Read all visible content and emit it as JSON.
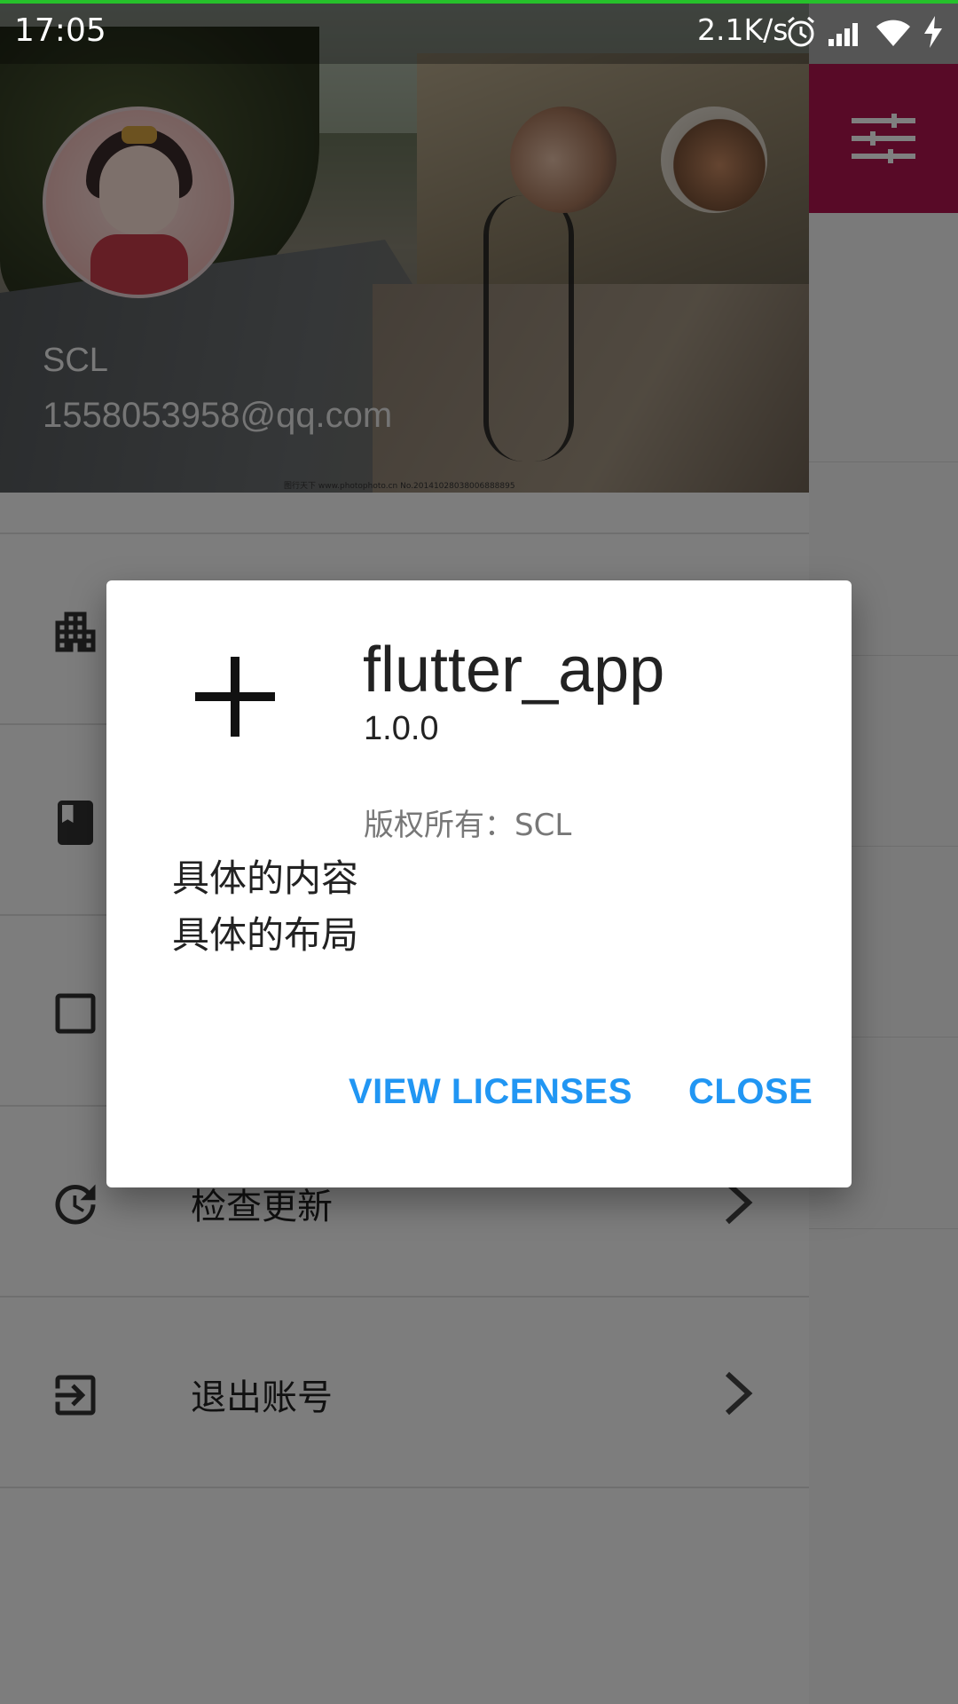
{
  "status_bar": {
    "time": "17:05",
    "net_speed": "2.1K/s",
    "icons": [
      "alarm-icon",
      "signal-icon",
      "wifi-icon",
      "charging-icon"
    ]
  },
  "app_bar": {
    "action_icon": "tune-icon"
  },
  "drawer": {
    "user": {
      "name": "SCL",
      "email": "1558053958@qq.com"
    },
    "watermark": "图行天下 www.photophoto.cn No.20141028038006888895",
    "items": [
      {
        "icon": "apartment-icon",
        "label": ""
      },
      {
        "icon": "book-icon",
        "label": ""
      },
      {
        "icon": "checkbox-icon",
        "label": ""
      },
      {
        "icon": "update-icon",
        "label": "检查更新"
      },
      {
        "icon": "logout-icon",
        "label": "退出账号"
      }
    ]
  },
  "dialog": {
    "app_icon": "add-icon",
    "app_name": "flutter_app",
    "version": "1.0.0",
    "legalese": "版权所有：SCL",
    "content": [
      "具体的内容",
      "具体的布局"
    ],
    "buttons": {
      "view_licenses": "VIEW LICENSES",
      "close": "CLOSE"
    }
  },
  "colors": {
    "accent": "#2196f3",
    "app_bar": "#b0154e",
    "progress": "#26c12b"
  }
}
